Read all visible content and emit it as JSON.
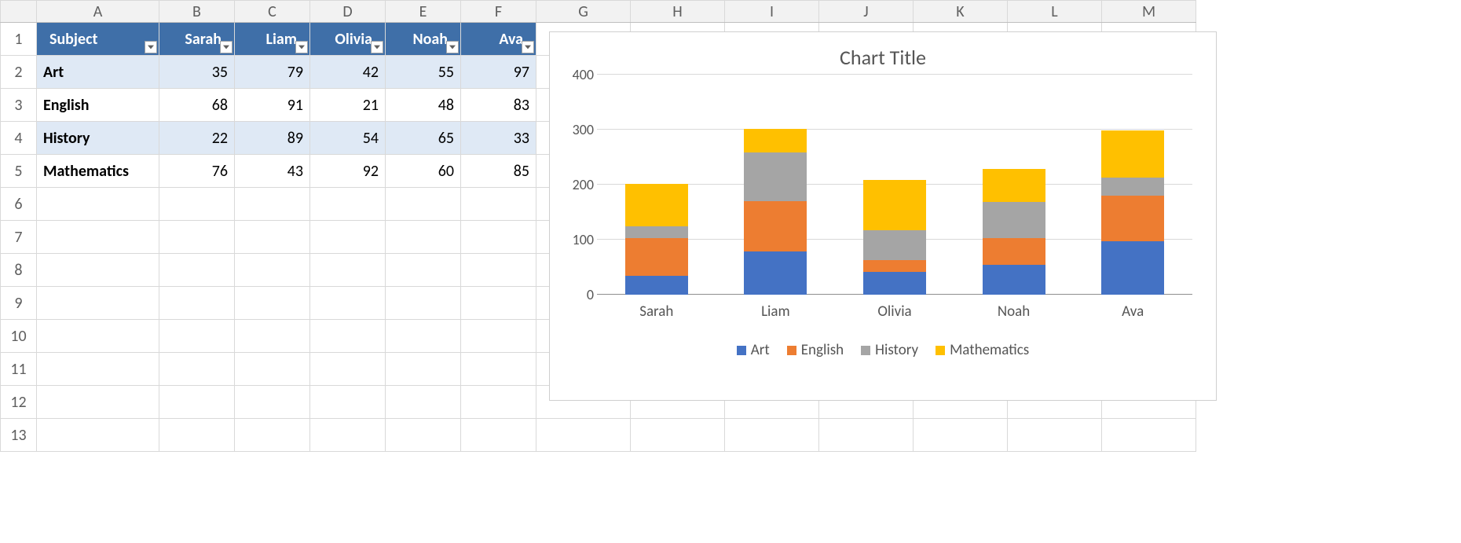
{
  "columns": [
    "A",
    "B",
    "C",
    "D",
    "E",
    "F",
    "G",
    "H",
    "I",
    "J",
    "K",
    "L",
    "M"
  ],
  "row_numbers": [
    "1",
    "2",
    "3",
    "4",
    "5",
    "6",
    "7",
    "8",
    "9",
    "10",
    "11",
    "12",
    "13"
  ],
  "table": {
    "headers": [
      "Subject",
      "Sarah",
      "Liam",
      "Olivia",
      "Noah",
      "Ava"
    ],
    "rows": [
      {
        "label": "Art",
        "values": [
          "35",
          "79",
          "42",
          "55",
          "97"
        ]
      },
      {
        "label": "English",
        "values": [
          "68",
          "91",
          "21",
          "48",
          "83"
        ]
      },
      {
        "label": "History",
        "values": [
          "22",
          "89",
          "54",
          "65",
          "33"
        ]
      },
      {
        "label": "Mathematics",
        "values": [
          "76",
          "43",
          "92",
          "60",
          "85"
        ]
      }
    ]
  },
  "chart": {
    "title": "Chart Title",
    "legend": [
      "Art",
      "English",
      "History",
      "Mathematics"
    ],
    "x_labels": [
      "Sarah",
      "Liam",
      "Olivia",
      "Noah",
      "Ava"
    ],
    "y_ticks": [
      "0",
      "100",
      "200",
      "300",
      "400"
    ]
  },
  "chart_data": {
    "type": "bar",
    "stacked": true,
    "title": "Chart Title",
    "xlabel": "",
    "ylabel": "",
    "ylim": [
      0,
      400
    ],
    "categories": [
      "Sarah",
      "Liam",
      "Olivia",
      "Noah",
      "Ava"
    ],
    "series": [
      {
        "name": "Art",
        "values": [
          35,
          79,
          42,
          55,
          97
        ],
        "color": "#4472C4"
      },
      {
        "name": "English",
        "values": [
          68,
          91,
          21,
          48,
          83
        ],
        "color": "#ED7D31"
      },
      {
        "name": "History",
        "values": [
          22,
          89,
          54,
          65,
          33
        ],
        "color": "#A5A5A5"
      },
      {
        "name": "Mathematics",
        "values": [
          76,
          43,
          92,
          60,
          85
        ],
        "color": "#FFC000"
      }
    ],
    "legend_position": "bottom"
  }
}
